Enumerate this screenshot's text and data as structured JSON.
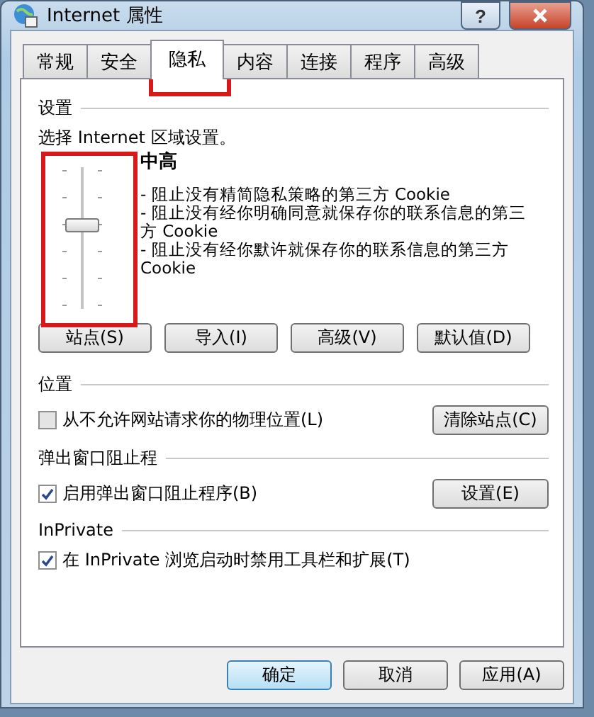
{
  "window": {
    "title": "Internet 属性",
    "help": "?"
  },
  "tabs": [
    {
      "label": "常规",
      "selected": false
    },
    {
      "label": "安全",
      "selected": false
    },
    {
      "label": "隐私",
      "selected": true
    },
    {
      "label": "内容",
      "selected": false
    },
    {
      "label": "连接",
      "selected": false
    },
    {
      "label": "程序",
      "selected": false
    },
    {
      "label": "高级",
      "selected": false
    }
  ],
  "settings": {
    "heading": "设置",
    "prompt": "选择 Internet 区域设置。",
    "slider": {
      "level": 0.6
    },
    "level_name": "中高",
    "bullets": [
      "- 阻止没有精简隐私策略的第三方 Cookie",
      "- 阻止没有经你明确同意就保存你的联系信息的第三方 Cookie",
      "- 阻止没有经你默许就保存你的联系信息的第三方 Cookie"
    ],
    "buttons": [
      "站点(S)",
      "导入(I)",
      "高级(V)",
      "默认值(D)"
    ]
  },
  "location": {
    "heading": "位置",
    "checkbox": {
      "label": "从不允许网站请求你的物理位置(L)",
      "checked": false
    },
    "button": "清除站点(C)"
  },
  "popup_blocker": {
    "heading": "弹出窗口阻止程",
    "checkbox": {
      "label": "启用弹出窗口阻止程序(B)",
      "checked": true
    },
    "button": "设置(E)"
  },
  "inprivate": {
    "heading": "InPrivate",
    "checkbox": {
      "label": "在 InPrivate 浏览启动时禁用工具栏和扩展(T)",
      "checked": true
    }
  },
  "dialog_buttons": [
    {
      "label": "确定",
      "default": true
    },
    {
      "label": "取消",
      "default": false
    },
    {
      "label": "应用(A)",
      "default": false
    }
  ]
}
